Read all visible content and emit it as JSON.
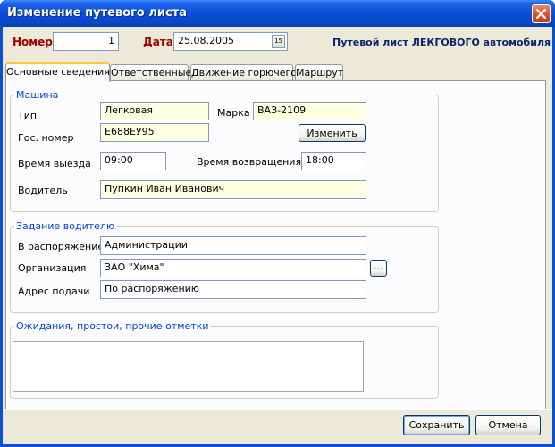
{
  "window": {
    "title": "Изменение путевого листа"
  },
  "header": {
    "number_label": "Номер",
    "number_value": "1",
    "date_label": "Дата",
    "date_value": "25.08.2005",
    "calendar_glyph": "15",
    "doc_type": "Путевой лист ЛЕКГОВОГО автомобиля"
  },
  "tabs": [
    {
      "label": "Основные сведения",
      "active": true
    },
    {
      "label": "Ответственные",
      "active": false
    },
    {
      "label": "Движение горючего",
      "active": false
    },
    {
      "label": "Маршрут",
      "active": false
    }
  ],
  "car_group": {
    "legend": "Машина",
    "type_label": "Тип",
    "type_value": "Легковая",
    "brand_label": "Марка",
    "brand_value": "ВАЗ-2109",
    "plate_label": "Гос. номер",
    "plate_value": "Е688ЕУ95",
    "change_button": "Изменить",
    "departure_label": "Время выезда",
    "departure_value": "09:00",
    "return_label": "Время возвращения",
    "return_value": "18:00",
    "driver_label": "Водитель",
    "driver_value": "Пупкин Иван Иванович"
  },
  "task_group": {
    "legend": "Задание водителю",
    "disposal_label": "В распоряжение",
    "disposal_value": "Администрации",
    "org_label": "Организация",
    "org_value": "ЗАО \"Хима\"",
    "org_browse": "...",
    "address_label": "Адрес подачи",
    "address_value": "По распоряжению"
  },
  "notes_group": {
    "legend": "Ожидания, простои, прочие отметки",
    "value": ""
  },
  "footer": {
    "save_button": "Сохранить",
    "cancel_button": "Отмена"
  },
  "colors": {
    "title_bar": "#0b4fd8",
    "window_bg": "#ece9d8",
    "label_red": "#a00000",
    "label_navy": "#0a246a",
    "group_legend": "#0046d5",
    "readonly_field": "#ffffe1"
  }
}
